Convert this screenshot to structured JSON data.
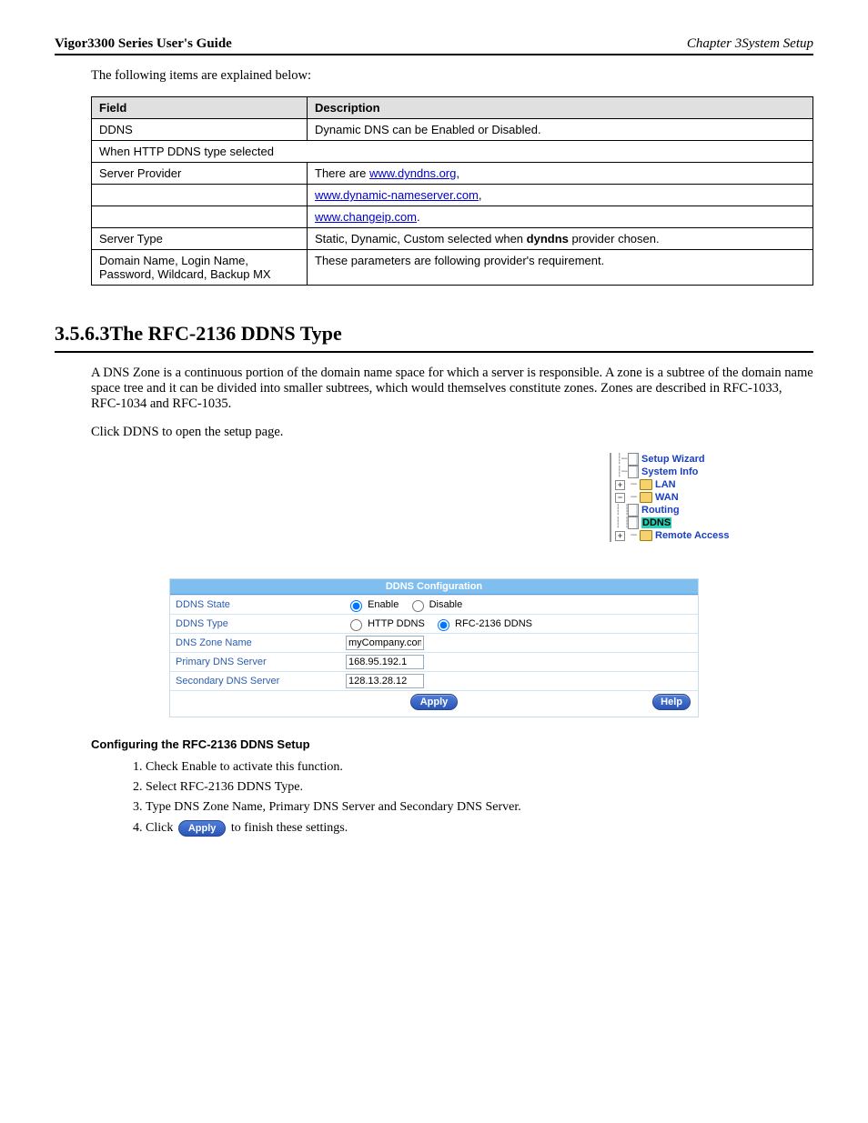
{
  "header": {
    "title": "Vigor3300 Series User's Guide",
    "subtitle": "Chapter 3System Setup"
  },
  "intro": "The following items are explained below:",
  "table": {
    "field": "Field",
    "desc": "Description",
    "rows": [
      {
        "label": "DDNS",
        "desc": "Dynamic DNS can be Enabled or Disabled."
      },
      {
        "label": "When HTTP DDNS type selected",
        "span": true
      },
      {
        "label": "Server Provider",
        "desc": "There are <a href='http://www.dyndns.org/'>www.dyndns.org</a>,"
      },
      {
        "label": "",
        "desc": "<a href='http://www.dynamic-nameserver.com/'>www.dynamic-nameserver.com</a>,"
      },
      {
        "label": "",
        "desc": "<a href='http://www.changeip.com/'>www.changeip.com</a>."
      },
      {
        "label": "Server Type",
        "desc": "Static, Dynamic, Custom selected when <b>dyndns</b> provider chosen."
      },
      {
        "label": "Domain Name, Login Name, Password, Wildcard, Backup MX",
        "desc": "These parameters are following provider's requirement."
      }
    ]
  },
  "section": {
    "title": "3.5.6.3The RFC-2136 DDNS Type"
  },
  "body1": "A DNS Zone is a continuous portion of the domain name space for which a server is responsible. A zone is a subtree of the domain name space tree and it can be divided into smaller subtrees, which would themselves constitute zones. Zones are described in RFC-1033, RFC-1034 and RFC-1035.",
  "body2": "Click DDNS to open the setup page.",
  "nav": {
    "items": [
      "Setup Wizard",
      "System Info",
      "LAN",
      "WAN",
      "Routing",
      "DDNS",
      "Remote Access"
    ]
  },
  "panel": {
    "title": "DDNS Configuration",
    "rows": {
      "state": {
        "label": "DDNS State",
        "opt1": "Enable",
        "opt2": "Disable"
      },
      "type": {
        "label": "DDNS Type",
        "opt1": "HTTP DDNS",
        "opt2": "RFC-2136 DDNS"
      },
      "zone": {
        "label": "DNS Zone Name",
        "value": "myCompany.com"
      },
      "primary": {
        "label": "Primary DNS Server",
        "value": "168.95.192.1"
      },
      "secondary": {
        "label": "Secondary DNS Server",
        "value": "128.13.28.12"
      }
    },
    "apply": "Apply",
    "help": "Help"
  },
  "sub1": "Configuring the RFC-2136 DDNS Setup",
  "steps": [
    "Check Enable to activate this function.",
    "Select RFC-2136 DDNS Type.",
    "Type DNS Zone Name, Primary DNS Server and Secondary DNS Server.",
    "Click  to finish these settings."
  ],
  "apply_inline": "Apply"
}
